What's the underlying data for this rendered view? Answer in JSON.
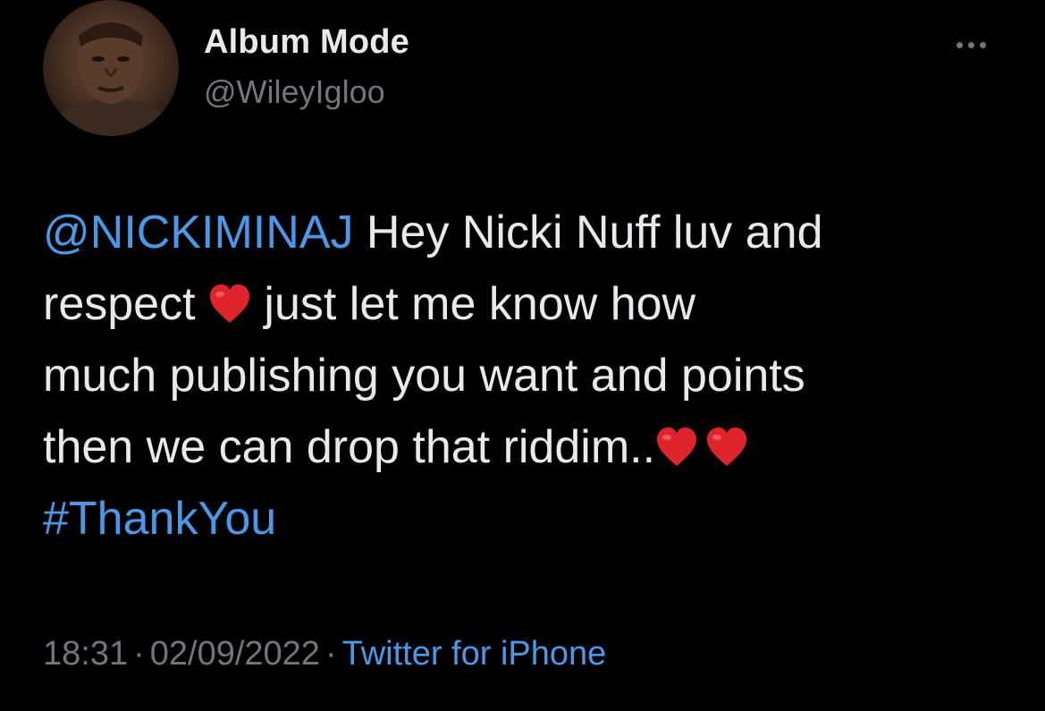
{
  "author": {
    "display_name": "Album Mode",
    "handle": "@WileyIgloo"
  },
  "tweet": {
    "mention": "@NICKIMINAJ",
    "line1_rest": " Hey Nicki Nuff luv and",
    "line2_a": "respect ",
    "line2_b": " just let me know how",
    "line3": "much publishing you want and points",
    "line4": "then we can drop that riddim..",
    "hashtag": "#ThankYou"
  },
  "meta": {
    "time": "18:31",
    "separator": "·",
    "date": "02/09/2022",
    "source": "Twitter for iPhone"
  },
  "icons": {
    "heart_emoji": "red-heart",
    "more": "more-options"
  },
  "colors": {
    "background": "#000000",
    "text": "#e7e9ea",
    "secondary": "#71767b",
    "link": "#4a99e9",
    "heart": "#e0242b"
  }
}
